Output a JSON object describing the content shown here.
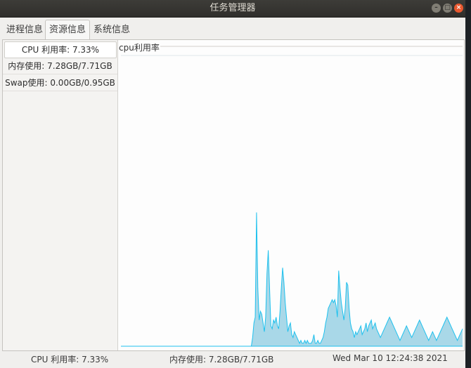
{
  "window": {
    "title": "任务管理器"
  },
  "tabs": [
    {
      "label": "进程信息"
    },
    {
      "label": "资源信息",
      "selected": true
    },
    {
      "label": "系统信息"
    }
  ],
  "sidebar": {
    "items": [
      {
        "label": "CPU 利用率:  7.33%",
        "selected": true
      },
      {
        "label": "内存使用:  7.28GB/7.71GB"
      },
      {
        "label": "Swap使用:  0.00GB/0.95GB"
      }
    ]
  },
  "chart_data": {
    "type": "area",
    "title": "cpu利用率",
    "xlabel": "",
    "ylabel": "",
    "ylim": [
      0,
      100
    ],
    "grid": false,
    "fill_color": "#a9d8e8",
    "line_color": "#1ec1ee",
    "values": [
      0,
      0,
      0,
      0,
      0,
      0,
      0,
      0,
      0,
      0,
      0,
      0,
      0,
      0,
      0,
      0,
      0,
      0,
      0,
      0,
      0,
      0,
      0,
      0,
      0,
      0,
      0,
      0,
      0,
      0,
      0,
      0,
      0,
      0,
      0,
      0,
      0,
      0,
      0,
      0,
      0,
      0,
      0,
      0,
      0,
      0,
      0,
      0,
      0,
      0,
      0,
      0,
      0,
      0,
      0,
      0,
      0,
      0,
      0,
      0,
      0,
      0,
      0,
      0,
      0,
      0,
      0,
      0,
      0,
      0,
      0,
      0,
      0,
      0,
      0,
      0,
      0,
      0,
      0,
      0,
      0,
      0,
      0,
      0,
      0,
      0,
      0,
      0,
      0,
      0,
      0,
      0,
      0,
      0,
      0,
      0,
      0,
      0,
      0,
      0,
      0,
      3,
      8,
      10,
      46,
      20,
      9,
      12,
      11,
      8,
      5,
      10,
      25,
      33,
      20,
      7,
      6,
      9,
      8,
      10,
      7,
      6,
      12,
      20,
      27,
      22,
      15,
      10,
      5,
      7,
      8,
      4,
      3,
      5,
      4,
      3,
      2,
      1,
      2,
      1,
      1,
      2,
      1,
      2,
      1,
      1,
      1,
      2,
      4,
      1,
      1,
      2,
      1,
      1,
      2,
      3,
      5,
      8,
      10,
      13,
      14,
      15,
      16,
      15,
      16,
      14,
      10,
      26,
      20,
      15,
      12,
      9,
      13,
      22,
      21,
      13,
      8,
      6,
      5,
      3,
      5,
      4,
      5,
      6,
      7,
      4,
      5,
      6,
      8,
      5,
      7,
      8,
      9,
      6,
      7,
      8,
      6,
      5,
      4,
      3,
      4,
      5,
      6,
      7,
      8,
      9,
      10,
      9,
      8,
      7,
      6,
      5,
      4,
      3,
      2,
      3,
      4,
      5,
      6,
      7,
      6,
      5,
      4,
      3,
      4,
      5,
      6,
      7,
      8,
      9,
      8,
      7,
      6,
      5,
      4,
      3,
      2,
      3,
      4,
      5,
      4,
      3,
      2,
      3,
      4,
      5,
      6,
      7,
      8,
      9,
      10,
      9,
      8,
      7,
      6,
      5,
      4,
      3,
      2,
      3,
      4,
      5,
      6
    ]
  },
  "status": {
    "cpu": "CPU 利用率:  7.33%",
    "mem": "内存使用:  7.28GB/7.71GB",
    "time": "Wed Mar 10 12:24:38 2021"
  },
  "icons": {
    "minimize": "minimize-icon",
    "maximize": "maximize-icon",
    "close": "close-icon"
  }
}
